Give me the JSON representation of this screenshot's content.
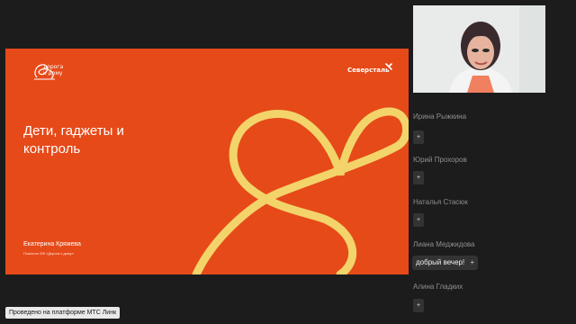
{
  "slide": {
    "logo_text": "дорога\nк дому",
    "brand": "Северсталь",
    "title": "Дети, гаджеты и контроль",
    "speaker_name": "Екатерина Кряжева",
    "speaker_role": "Психолог БФ «Дорога к дому»",
    "colors": {
      "background": "#e64a19",
      "heart": "#f3d46a"
    }
  },
  "participants": [
    {
      "name": "Ирина Рыжкина",
      "action": "+"
    },
    {
      "name": "Юрий Прохоров",
      "action": "+"
    },
    {
      "name": "Наталья Стасюк",
      "action": "+"
    },
    {
      "name": "Лиана Меджидова",
      "message": "добрый вечер!",
      "action": "+"
    },
    {
      "name": "Алина Гладких",
      "action": "+"
    }
  ],
  "footer": {
    "platform": "Проведено на платформе МТС Линк"
  },
  "icons": [
    "heart-graphic",
    "brand-mark-icon",
    "logo-mark-icon"
  ]
}
